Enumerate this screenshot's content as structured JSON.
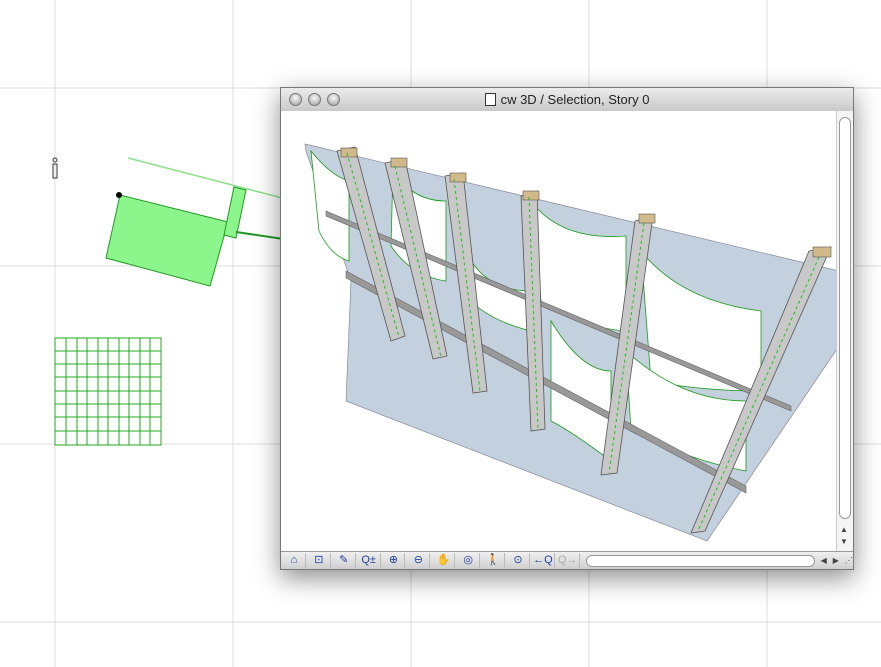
{
  "window": {
    "title": "cw 3D / Selection, Story 0"
  },
  "toolbar": {
    "buttons": [
      {
        "name": "3d-navigation-icon",
        "glyph": "⌂"
      },
      {
        "name": "fit-in-window-icon",
        "glyph": "⊡"
      },
      {
        "name": "edit-path-icon",
        "glyph": "✎"
      },
      {
        "name": "zoom-toggle-icon",
        "glyph": "Q±"
      },
      {
        "name": "zoom-in-icon",
        "glyph": "⊕"
      },
      {
        "name": "zoom-out-icon",
        "glyph": "⊖"
      },
      {
        "name": "pan-hand-icon",
        "glyph": "✋"
      },
      {
        "name": "orbit-icon",
        "glyph": "◎"
      },
      {
        "name": "explore-walk-icon",
        "glyph": "🚶"
      },
      {
        "name": "zoom-fit-icon",
        "glyph": "⊙"
      },
      {
        "name": "previous-zoom-icon",
        "glyph": "←Q"
      },
      {
        "name": "next-zoom-icon",
        "glyph": "Q→"
      }
    ]
  },
  "colors": {
    "accent_green": "#8cf58c",
    "glass": "#c3d0dd"
  }
}
